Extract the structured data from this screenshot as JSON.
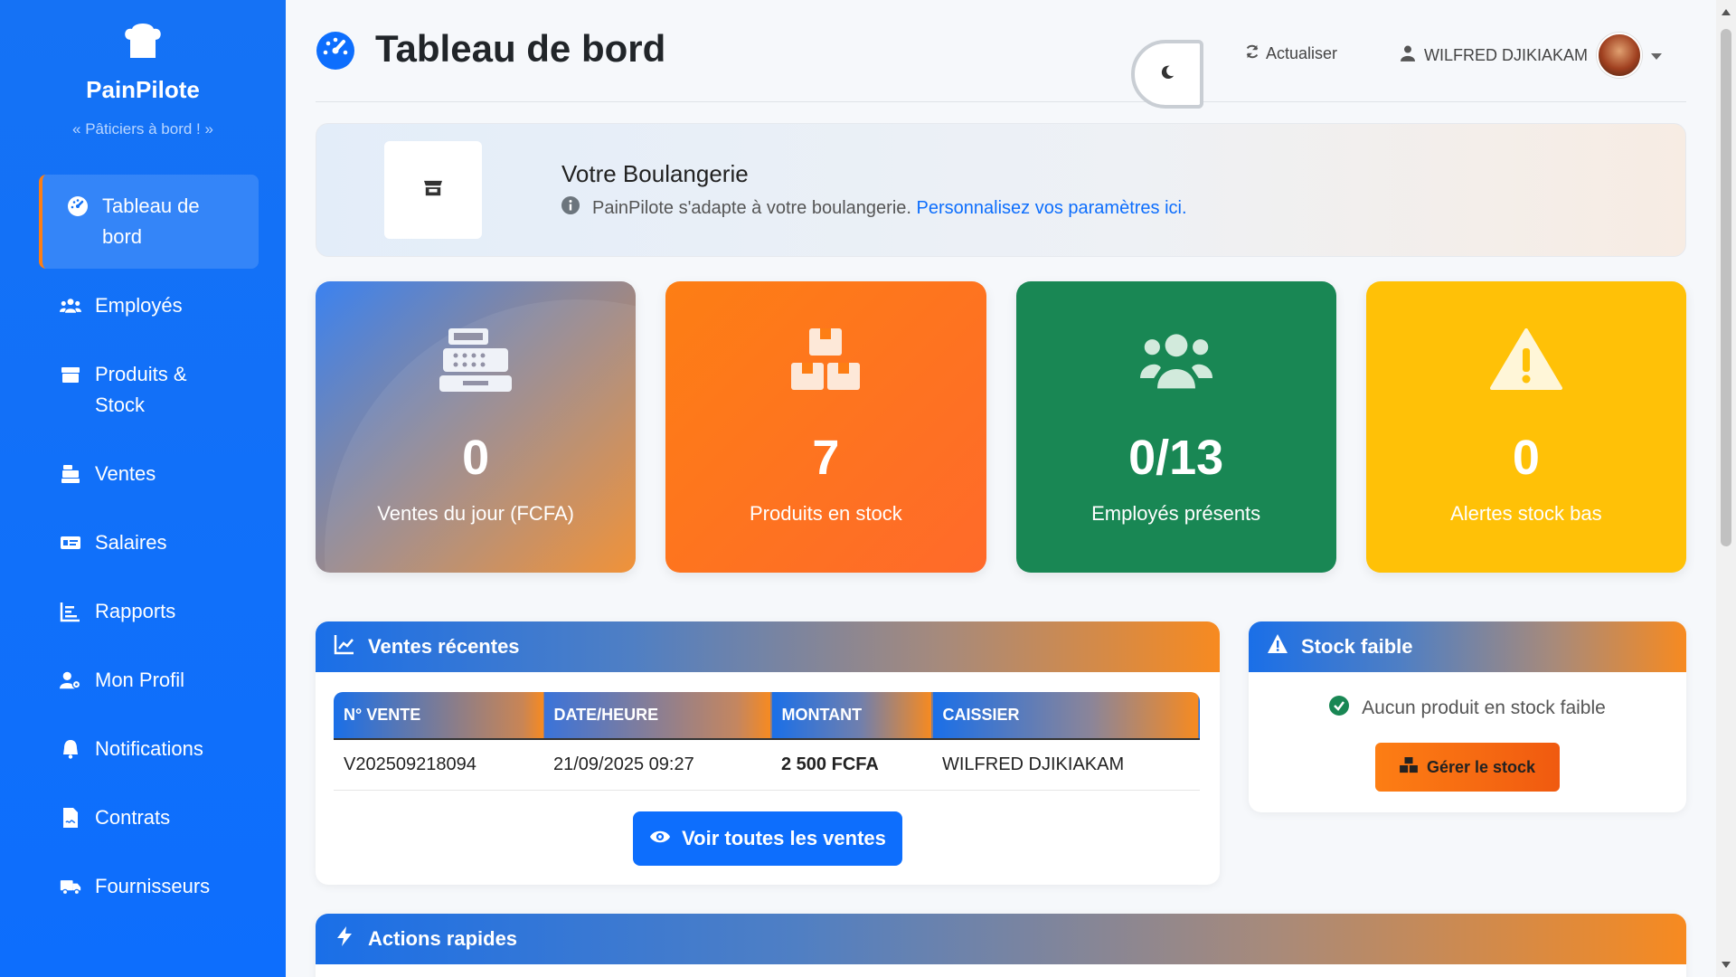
{
  "brand": {
    "name": "PainPilote",
    "tagline": "« Pâticiers à bord ! »",
    "icon": "chef-hat-icon"
  },
  "sidebar": {
    "items": [
      {
        "label": "Tableau de bord",
        "icon": "gauge-icon",
        "active": true
      },
      {
        "label": "Employés",
        "icon": "users-icon"
      },
      {
        "label": "Produits & Stock",
        "icon": "box-icon"
      },
      {
        "label": "Ventes",
        "icon": "cash-register-icon"
      },
      {
        "label": "Salaires",
        "icon": "money-bill-icon"
      },
      {
        "label": "Rapports",
        "icon": "chart-bar-icon"
      },
      {
        "label": "Mon Profil",
        "icon": "user-cog-icon"
      },
      {
        "label": "Notifications",
        "icon": "bell-icon"
      },
      {
        "label": "Contrats",
        "icon": "file-contract-icon"
      },
      {
        "label": "Fournisseurs",
        "icon": "truck-icon"
      }
    ]
  },
  "header": {
    "title": "Tableau de bord",
    "refresh_label": "Actualiser",
    "user_name": "WILFRED DJIKIAKAM"
  },
  "banner": {
    "title": "Votre Boulangerie",
    "text": "PainPilote s'adapte à votre boulangerie.",
    "link": "Personnalisez vos paramètres ici."
  },
  "stats": [
    {
      "value": "0",
      "label": "Ventes du jour (FCFA)",
      "icon": "cash-register-icon"
    },
    {
      "value": "7",
      "label": "Produits en stock",
      "icon": "boxes-icon"
    },
    {
      "value": "0/13",
      "label": "Employés présents",
      "icon": "users-icon"
    },
    {
      "value": "0",
      "label": "Alertes stock bas",
      "icon": "warning-icon"
    }
  ],
  "recent_sales": {
    "title": "Ventes récentes",
    "columns": [
      "N° VENTE",
      "DATE/HEURE",
      "MONTANT",
      "CAISSIER"
    ],
    "rows": [
      [
        "V202509218094",
        "21/09/2025 09:27",
        "2 500 FCFA",
        "WILFRED DJIKIAKAM"
      ]
    ],
    "button": "Voir toutes les ventes"
  },
  "low_stock": {
    "title": "Stock faible",
    "message": "Aucun produit en stock faible",
    "button": "Gérer le stock"
  },
  "quick_actions": {
    "title": "Actions rapides"
  },
  "colors": {
    "primary": "#0d6efd",
    "orange": "#fd7e14",
    "green": "#198754",
    "yellow": "#ffc107"
  }
}
